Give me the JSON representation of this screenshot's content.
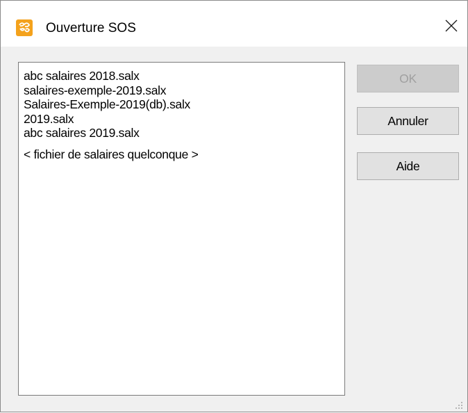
{
  "window": {
    "title": "Ouverture SOS",
    "icon": "app-logo-icon",
    "close_icon": "close-icon"
  },
  "list": {
    "items": [
      "abc salaires 2018.salx",
      "salaires-exemple-2019.salx",
      "Salaires-Exemple-2019(db).salx",
      "2019.salx",
      "abc salaires 2019.salx"
    ],
    "generic_item": "< fichier de salaires quelconque >"
  },
  "buttons": {
    "ok_label": "OK",
    "cancel_label": "Annuler",
    "help_label": "Aide"
  },
  "colors": {
    "dialog_background": "#f0f0f0",
    "title_background": "#ffffff",
    "icon_orange": "#f4a21c",
    "disabled_text": "#a0a0a0"
  }
}
